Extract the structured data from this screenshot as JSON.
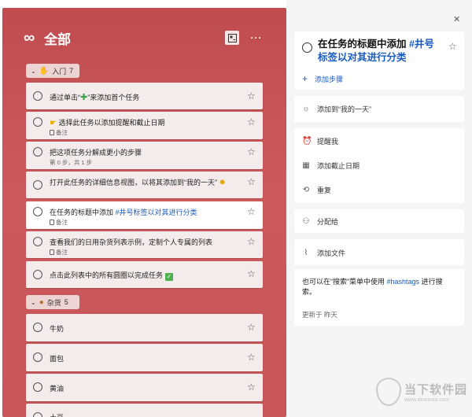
{
  "list": {
    "title": "全部",
    "groups": [
      {
        "emoji": "👋",
        "label": "入门",
        "count": "7"
      },
      {
        "emoji": "🍪",
        "label": "杂货",
        "count": "5"
      }
    ],
    "tasks": [
      {
        "pre": "通过单击“",
        "post": "”来添加首个任务"
      },
      {
        "title": "选择此任务以添加提醒和截止日期",
        "note": "备注"
      },
      {
        "title": "把这项任务分解成更小的步骤",
        "meta": "第 0 步，共 1 步"
      },
      {
        "title": "打开此任务的详细信息视图，以将其添加到“我的一天”"
      },
      {
        "pre": "在任务的标题中添加 ",
        "tag": "#井号标签以对其进行分类",
        "note": "备注"
      },
      {
        "title": "查看我们的日用杂货列表示例，定制个人专属的列表",
        "note": "备注"
      },
      {
        "title": "点击此列表中的所有圆圈以完成任务"
      }
    ],
    "grocery": [
      "牛奶",
      "面包",
      "黄油",
      "土豆"
    ]
  },
  "detail": {
    "title_pre": "在任务的标题中添加 ",
    "title_tag": "#井号标签以对其进行分类",
    "add_step": "添加步骤",
    "my_day": "添加到“我的一天”",
    "remind": "提醒我",
    "due": "添加截止日期",
    "repeat": "重复",
    "assign": "分配给",
    "file": "添加文件",
    "note_pre": "也可以在“搜索”菜单中使用 ",
    "note_tag": "#hashtags",
    "note_post": " 进行搜索。",
    "updated": "更新于 昨天"
  },
  "watermark": {
    "name": "当下软件园",
    "url": "www.downxia.com"
  },
  "colors": {
    "list_bg": "#c04c4f",
    "accent_blue": "#1a5bbf"
  }
}
